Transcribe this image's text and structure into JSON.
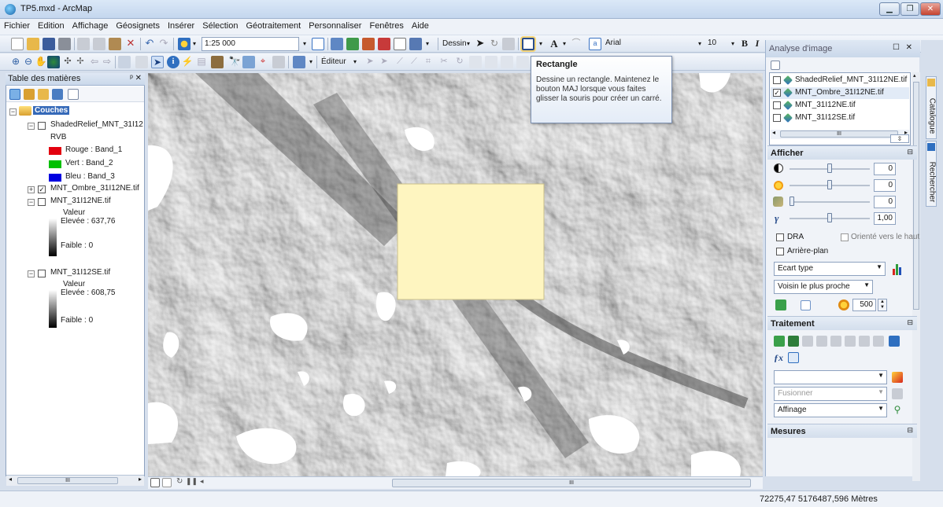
{
  "window": {
    "title": "TP5.mxd - ArcMap"
  },
  "menu": [
    "Fichier",
    "Edition",
    "Affichage",
    "Géosignets",
    "Insérer",
    "Sélection",
    "Géotraitement",
    "Personnaliser",
    "Fenêtres",
    "Aide"
  ],
  "toolbar": {
    "scale": "1:25 000",
    "dessin_label": "Dessin",
    "editeur_label": "Éditeur",
    "font": "Arial",
    "font_size": "10",
    "bold": "B",
    "italic": "I",
    "text_tool": "A"
  },
  "tooltip": {
    "title": "Rectangle",
    "body": "Dessine un rectangle. Maintenez le bouton MAJ lorsque vous faites glisser la souris pour créer un carré."
  },
  "toc": {
    "title": "Table des matières",
    "pin": "ᵖ ✕",
    "root": "Couches",
    "layers": [
      {
        "name": "ShadedRelief_MNT_31I12",
        "checked": false,
        "expanded": true
      },
      {
        "name": "MNT_Ombre_31I12NE.tif",
        "checked": true,
        "expanded": false
      },
      {
        "name": "MNT_31I12NE.tif",
        "checked": false,
        "expanded": true
      },
      {
        "name": "MNT_31I12SE.tif",
        "checked": false,
        "expanded": true
      }
    ],
    "rvb": "RVB",
    "bands": [
      {
        "label": "Rouge :  Band_1",
        "color": "#e3000f"
      },
      {
        "label": "Vert :  Band_2",
        "color": "#00c000"
      },
      {
        "label": "Bleu :  Band_3",
        "color": "#0000e0"
      }
    ],
    "legend1": {
      "valeur": "Valeur",
      "high": "Elevée : 637,76",
      "low": "Faible : 0"
    },
    "legend2": {
      "valeur": "Valeur",
      "high": "Elevée : 608,75",
      "low": "Faible : 0"
    }
  },
  "imgpanel": {
    "title": "Analyse d'image",
    "layers": [
      {
        "name": "ShadedRelief_MNT_31I12NE.tif",
        "checked": false
      },
      {
        "name": "MNT_Ombre_31I12NE.tif",
        "checked": true
      },
      {
        "name": "MNT_31I12NE.tif",
        "checked": false
      },
      {
        "name": "MNT_31I12SE.tif",
        "checked": false
      }
    ],
    "scroll_mid": "III",
    "afficher": "Afficher",
    "contrast": "0",
    "brightness": "0",
    "transparency": "0",
    "gamma": "1,00",
    "dra": "DRA",
    "oriente": "Orienté vers le haut",
    "arriere": "Arrière-plan",
    "stretch": "Ecart type",
    "resample": "Voisin le plus proche",
    "dpi": "500",
    "traitement": "Traitement",
    "fusionner": "Fusionner",
    "affinage": "Affinage",
    "mesures": "Mesures"
  },
  "sidetabs": {
    "catalogue": "Catalogue",
    "recherche": "Rechercher"
  },
  "status": {
    "coords": "72275,47  5176487,596 Mètres"
  },
  "map": {
    "scroll_mid": "III"
  }
}
